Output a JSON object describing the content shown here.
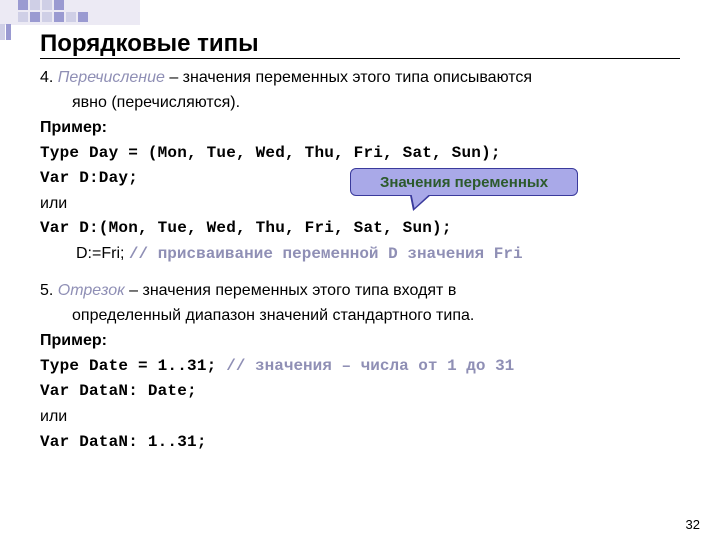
{
  "title": "Порядковые типы",
  "section4": {
    "num": "4. ",
    "term": "Перечисление",
    "def1": " – значения переменных этого типа описываются",
    "def2": "явно (перечисляются)."
  },
  "example_label": "Пример:",
  "code4": {
    "l1": "Type Day = (Mon, Tue, Wed, Thu, Fri, Sat, Sun);",
    "l2": "Var D:Day;",
    "or": "или",
    "l3": "Var D:(Mon, Tue, Wed, Thu, Fri, Sat, Sun);",
    "assign_lhs": "D:=Fri; ",
    "assign_comment": "// присваивание переменной D значения Fri"
  },
  "callout": "Значения переменных",
  "section5": {
    "num": "5. ",
    "term": "Отрезок",
    "def1": " – значения переменных этого типа входят в",
    "def2": "определенный диапазон значений стандартного типа."
  },
  "code5": {
    "l1a": "Type Date = 1..31; ",
    "l1b": "// значения – числа от 1 до 31",
    "l2": "Var DataN: Date;",
    "or": "или",
    "l3": "Var DataN: 1..31;"
  },
  "pagenum": "32"
}
